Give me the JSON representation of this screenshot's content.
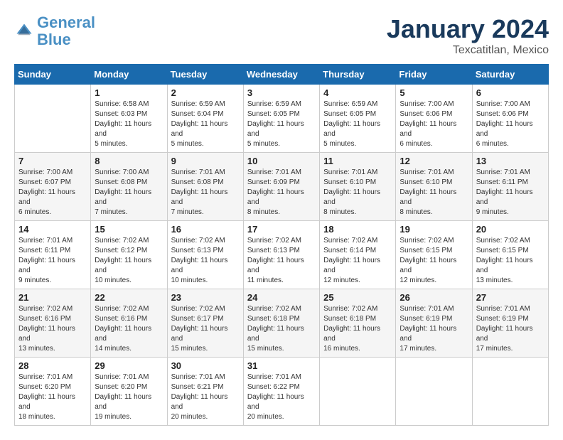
{
  "header": {
    "logo_line1": "General",
    "logo_line2": "Blue",
    "month": "January 2024",
    "location": "Texcatitlan, Mexico"
  },
  "weekdays": [
    "Sunday",
    "Monday",
    "Tuesday",
    "Wednesday",
    "Thursday",
    "Friday",
    "Saturday"
  ],
  "weeks": [
    [
      {
        "day": "",
        "sunrise": "",
        "sunset": "",
        "daylight": ""
      },
      {
        "day": "1",
        "sunrise": "Sunrise: 6:58 AM",
        "sunset": "Sunset: 6:03 PM",
        "daylight": "Daylight: 11 hours and 5 minutes."
      },
      {
        "day": "2",
        "sunrise": "Sunrise: 6:59 AM",
        "sunset": "Sunset: 6:04 PM",
        "daylight": "Daylight: 11 hours and 5 minutes."
      },
      {
        "day": "3",
        "sunrise": "Sunrise: 6:59 AM",
        "sunset": "Sunset: 6:05 PM",
        "daylight": "Daylight: 11 hours and 5 minutes."
      },
      {
        "day": "4",
        "sunrise": "Sunrise: 6:59 AM",
        "sunset": "Sunset: 6:05 PM",
        "daylight": "Daylight: 11 hours and 5 minutes."
      },
      {
        "day": "5",
        "sunrise": "Sunrise: 7:00 AM",
        "sunset": "Sunset: 6:06 PM",
        "daylight": "Daylight: 11 hours and 6 minutes."
      },
      {
        "day": "6",
        "sunrise": "Sunrise: 7:00 AM",
        "sunset": "Sunset: 6:06 PM",
        "daylight": "Daylight: 11 hours and 6 minutes."
      }
    ],
    [
      {
        "day": "7",
        "sunrise": "Sunrise: 7:00 AM",
        "sunset": "Sunset: 6:07 PM",
        "daylight": "Daylight: 11 hours and 6 minutes."
      },
      {
        "day": "8",
        "sunrise": "Sunrise: 7:00 AM",
        "sunset": "Sunset: 6:08 PM",
        "daylight": "Daylight: 11 hours and 7 minutes."
      },
      {
        "day": "9",
        "sunrise": "Sunrise: 7:01 AM",
        "sunset": "Sunset: 6:08 PM",
        "daylight": "Daylight: 11 hours and 7 minutes."
      },
      {
        "day": "10",
        "sunrise": "Sunrise: 7:01 AM",
        "sunset": "Sunset: 6:09 PM",
        "daylight": "Daylight: 11 hours and 8 minutes."
      },
      {
        "day": "11",
        "sunrise": "Sunrise: 7:01 AM",
        "sunset": "Sunset: 6:10 PM",
        "daylight": "Daylight: 11 hours and 8 minutes."
      },
      {
        "day": "12",
        "sunrise": "Sunrise: 7:01 AM",
        "sunset": "Sunset: 6:10 PM",
        "daylight": "Daylight: 11 hours and 8 minutes."
      },
      {
        "day": "13",
        "sunrise": "Sunrise: 7:01 AM",
        "sunset": "Sunset: 6:11 PM",
        "daylight": "Daylight: 11 hours and 9 minutes."
      }
    ],
    [
      {
        "day": "14",
        "sunrise": "Sunrise: 7:01 AM",
        "sunset": "Sunset: 6:11 PM",
        "daylight": "Daylight: 11 hours and 9 minutes."
      },
      {
        "day": "15",
        "sunrise": "Sunrise: 7:02 AM",
        "sunset": "Sunset: 6:12 PM",
        "daylight": "Daylight: 11 hours and 10 minutes."
      },
      {
        "day": "16",
        "sunrise": "Sunrise: 7:02 AM",
        "sunset": "Sunset: 6:13 PM",
        "daylight": "Daylight: 11 hours and 10 minutes."
      },
      {
        "day": "17",
        "sunrise": "Sunrise: 7:02 AM",
        "sunset": "Sunset: 6:13 PM",
        "daylight": "Daylight: 11 hours and 11 minutes."
      },
      {
        "day": "18",
        "sunrise": "Sunrise: 7:02 AM",
        "sunset": "Sunset: 6:14 PM",
        "daylight": "Daylight: 11 hours and 12 minutes."
      },
      {
        "day": "19",
        "sunrise": "Sunrise: 7:02 AM",
        "sunset": "Sunset: 6:15 PM",
        "daylight": "Daylight: 11 hours and 12 minutes."
      },
      {
        "day": "20",
        "sunrise": "Sunrise: 7:02 AM",
        "sunset": "Sunset: 6:15 PM",
        "daylight": "Daylight: 11 hours and 13 minutes."
      }
    ],
    [
      {
        "day": "21",
        "sunrise": "Sunrise: 7:02 AM",
        "sunset": "Sunset: 6:16 PM",
        "daylight": "Daylight: 11 hours and 13 minutes."
      },
      {
        "day": "22",
        "sunrise": "Sunrise: 7:02 AM",
        "sunset": "Sunset: 6:16 PM",
        "daylight": "Daylight: 11 hours and 14 minutes."
      },
      {
        "day": "23",
        "sunrise": "Sunrise: 7:02 AM",
        "sunset": "Sunset: 6:17 PM",
        "daylight": "Daylight: 11 hours and 15 minutes."
      },
      {
        "day": "24",
        "sunrise": "Sunrise: 7:02 AM",
        "sunset": "Sunset: 6:18 PM",
        "daylight": "Daylight: 11 hours and 15 minutes."
      },
      {
        "day": "25",
        "sunrise": "Sunrise: 7:02 AM",
        "sunset": "Sunset: 6:18 PM",
        "daylight": "Daylight: 11 hours and 16 minutes."
      },
      {
        "day": "26",
        "sunrise": "Sunrise: 7:01 AM",
        "sunset": "Sunset: 6:19 PM",
        "daylight": "Daylight: 11 hours and 17 minutes."
      },
      {
        "day": "27",
        "sunrise": "Sunrise: 7:01 AM",
        "sunset": "Sunset: 6:19 PM",
        "daylight": "Daylight: 11 hours and 17 minutes."
      }
    ],
    [
      {
        "day": "28",
        "sunrise": "Sunrise: 7:01 AM",
        "sunset": "Sunset: 6:20 PM",
        "daylight": "Daylight: 11 hours and 18 minutes."
      },
      {
        "day": "29",
        "sunrise": "Sunrise: 7:01 AM",
        "sunset": "Sunset: 6:20 PM",
        "daylight": "Daylight: 11 hours and 19 minutes."
      },
      {
        "day": "30",
        "sunrise": "Sunrise: 7:01 AM",
        "sunset": "Sunset: 6:21 PM",
        "daylight": "Daylight: 11 hours and 20 minutes."
      },
      {
        "day": "31",
        "sunrise": "Sunrise: 7:01 AM",
        "sunset": "Sunset: 6:22 PM",
        "daylight": "Daylight: 11 hours and 20 minutes."
      },
      {
        "day": "",
        "sunrise": "",
        "sunset": "",
        "daylight": ""
      },
      {
        "day": "",
        "sunrise": "",
        "sunset": "",
        "daylight": ""
      },
      {
        "day": "",
        "sunrise": "",
        "sunset": "",
        "daylight": ""
      }
    ]
  ]
}
